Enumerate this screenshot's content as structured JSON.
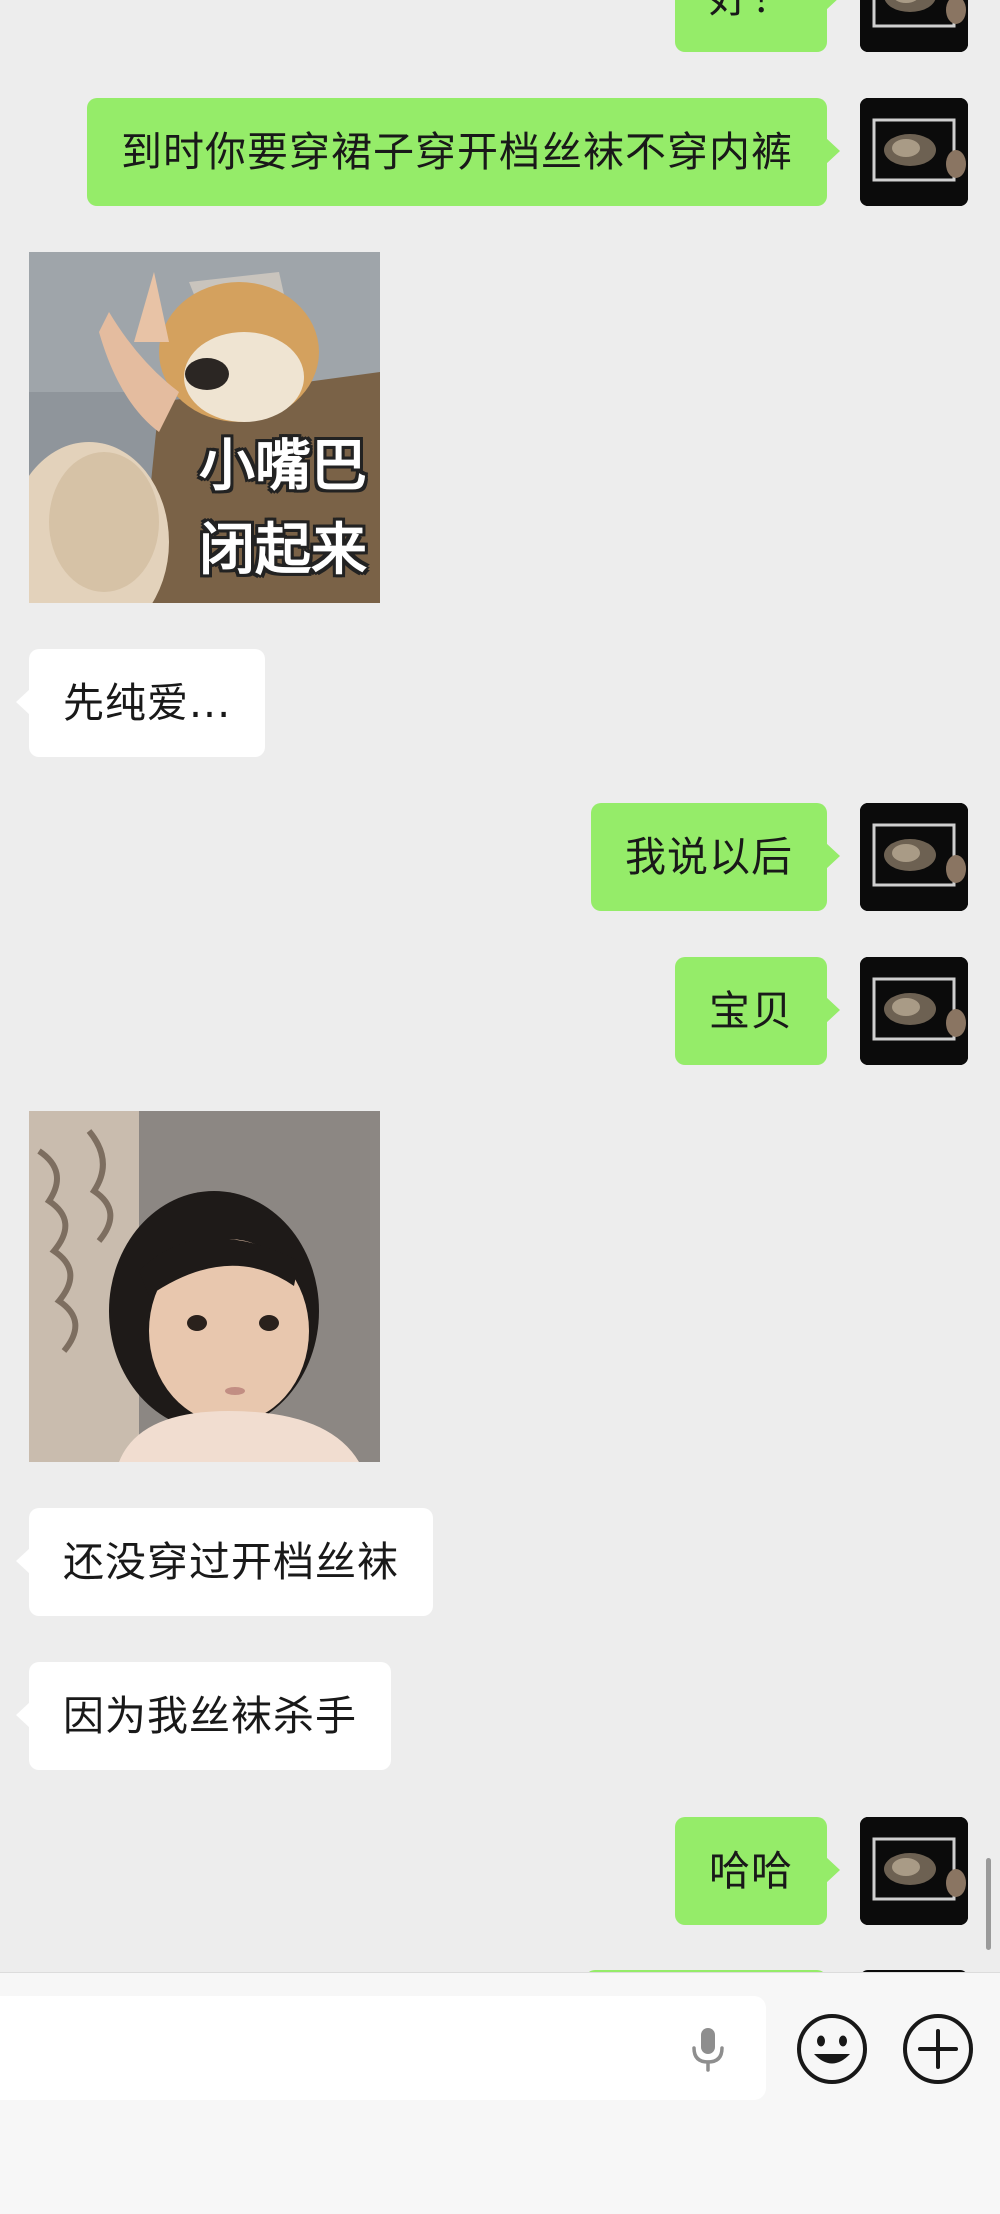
{
  "conversation": {
    "messages": [
      {
        "id": "m0",
        "direction": "outgoing",
        "type": "text",
        "text": "好！"
      },
      {
        "id": "m1",
        "direction": "outgoing",
        "type": "text",
        "text": "到时你要穿裙子穿开档丝袜不穿内裤"
      },
      {
        "id": "m2",
        "direction": "incoming",
        "type": "sticker",
        "sticker": "shiba-dog-hand-on-mouth",
        "caption_line1": "小嘴巴",
        "caption_line2": "闭起来"
      },
      {
        "id": "m3",
        "direction": "incoming",
        "type": "text",
        "text": "先纯爱..."
      },
      {
        "id": "m4",
        "direction": "outgoing",
        "type": "text",
        "text": "我说以后"
      },
      {
        "id": "m5",
        "direction": "outgoing",
        "type": "text",
        "text": "宝贝"
      },
      {
        "id": "m6",
        "direction": "incoming",
        "type": "sticker",
        "sticker": "toddler-staring"
      },
      {
        "id": "m7",
        "direction": "incoming",
        "type": "text",
        "text": "还没穿过开档丝袜"
      },
      {
        "id": "m8",
        "direction": "incoming",
        "type": "text",
        "text": "因为我丝袜杀手"
      },
      {
        "id": "m9",
        "direction": "outgoing",
        "type": "text",
        "text": "哈哈"
      }
    ]
  },
  "input_bar": {
    "text_value": "",
    "icons": [
      "microphone-icon",
      "emoji-icon",
      "plus-icon"
    ]
  },
  "colors": {
    "background": "#ededed",
    "outgoing_bubble": "#95ec69",
    "incoming_bubble": "#ffffff",
    "text": "#191919"
  }
}
